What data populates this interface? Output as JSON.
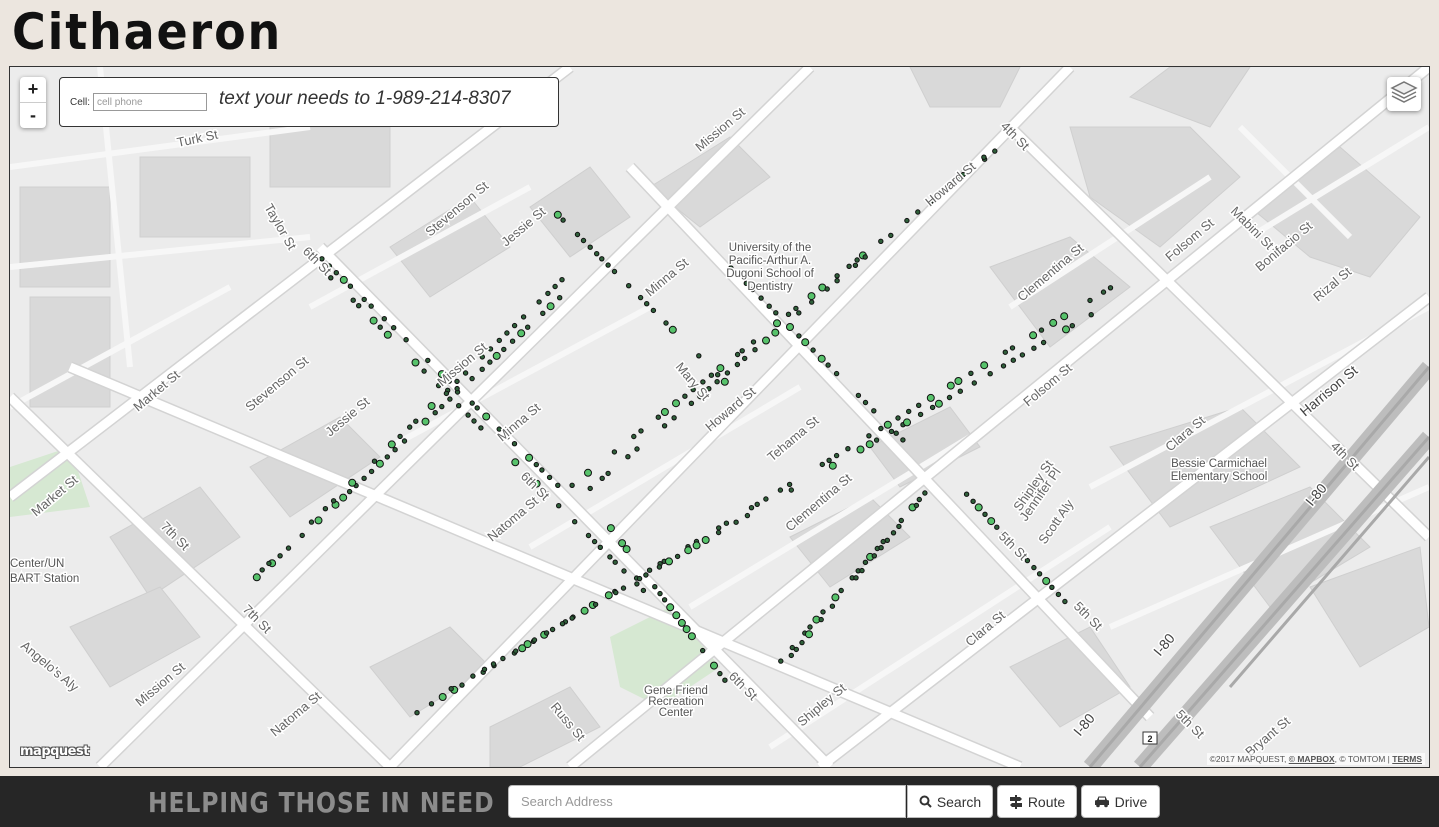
{
  "app": {
    "title": "Cithaeron"
  },
  "map": {
    "zoom_in_label": "+",
    "zoom_out_label": "-",
    "cell_label": "Cell:",
    "cell_placeholder": "cell phone",
    "sms_instruction": "text your needs to 1-989-214-8307",
    "provider_logo": "mapquest",
    "attribution": {
      "copyright": "©2017 MAPQUEST,",
      "mapbox": "© MAPBOX",
      "tomtom": ", © TOMTOM |",
      "terms": "TERMS"
    },
    "layers_icon": "layers-icon",
    "street_labels": [
      "Turk St",
      "Taylor St",
      "Market St",
      "Mission St",
      "Stevenson St",
      "Jessie St",
      "6th St",
      "Minna St",
      "Mary St",
      "Howard St",
      "Tehama St",
      "Natoma St",
      "Clementina St",
      "4th St",
      "Folsom St",
      "Mabini St",
      "Bonifacio St",
      "Rizal St",
      "Harrison St",
      "Clara St",
      "5th St",
      "Shipley St",
      "Jennifer Pl",
      "Scott Aly",
      "7th St",
      "Russ St",
      "Angelo's Aly",
      "Bryant St",
      "I-80"
    ],
    "places": [
      "University of the Pacific-Arthur A. Dugoni School of Dentistry",
      "Bessie Carmichael Elementary School",
      "Gene Friend Recreation Center",
      "Center/UN BART Station"
    ],
    "route_shield": "2",
    "colors": {
      "marker_fill": "#57c26b",
      "marker_stroke": "#111111",
      "road": "#ffffff",
      "building": "#d5d5d5",
      "park": "#cfe3cf"
    }
  },
  "footer": {
    "tagline": "HELPING THOSE IN NEED",
    "search_placeholder": "Search Address",
    "search_label": "Search",
    "route_label": "Route",
    "drive_label": "Drive"
  }
}
